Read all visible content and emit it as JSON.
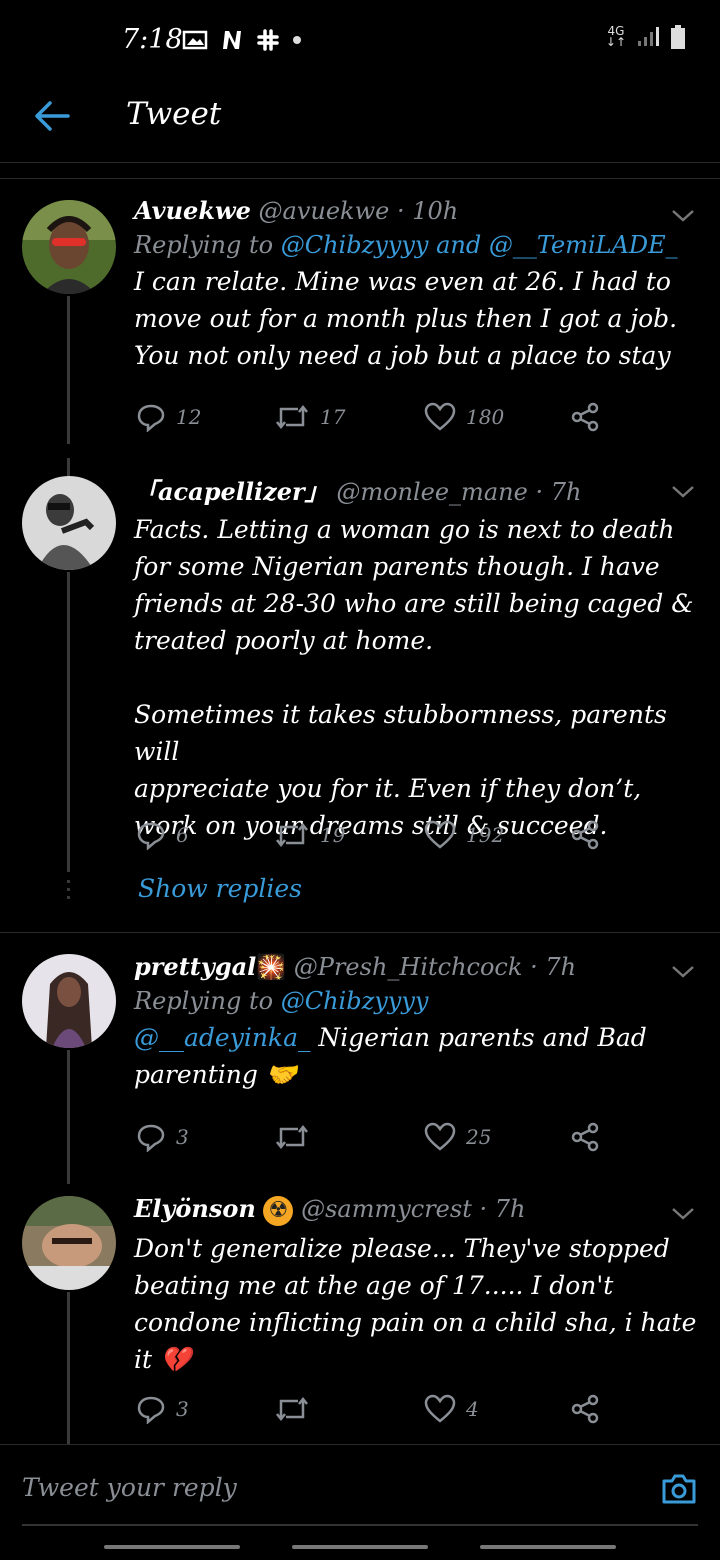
{
  "status_bar": {
    "time": "7:18",
    "network": "4G"
  },
  "header": {
    "title": "Tweet"
  },
  "tweets": [
    {
      "name": "Avuekwe",
      "handle": "@avuekwe",
      "time": "10h",
      "reply_prefix": "Replying to ",
      "reply_users": [
        "@Chibzyyyy",
        "@__TemiLADE_"
      ],
      "reply_joiner": " and ",
      "body": "I can relate. Mine was even at 26. I had to\nmove out for a month plus then I got a job.\nYou not only need a job but a place to stay",
      "replies": "12",
      "retweets": "17",
      "likes": "180"
    },
    {
      "name": "「acapellizer」",
      "handle": "@monlee_mane",
      "time": "7h",
      "body": "Facts. Letting a woman go is next to death\nfor some Nigerian parents though. I have\nfriends at 28-30 who are still being caged &\ntreated poorly at home.\n\nSometimes it takes stubbornness, parents will\nappreciate you for it. Even if they don’t,\nwork on your dreams still & succeed.",
      "replies": "6",
      "retweets": "19",
      "likes": "192",
      "show_replies": "Show replies"
    },
    {
      "name": "prettygal",
      "name_emoji": "🎇",
      "handle": "@Presh_Hitchcock",
      "time": "7h",
      "reply_prefix": "Replying to ",
      "reply_users": [
        "@Chibzyyyy"
      ],
      "mention": "@__adeyinka_",
      "body": " Nigerian parents and Bad\nparenting 🤝",
      "replies": "3",
      "retweets": "",
      "likes": "25"
    },
    {
      "name": "Elyönson",
      "name_emoji": "☢",
      "handle": "@sammycrest",
      "time": "7h",
      "body": "Don't generalize please... They've stopped\nbeating me at the age of 17..... I don't\ncondone inflicting pain on a child sha, i hate\nit 💔",
      "replies": "3",
      "retweets": "",
      "likes": "4"
    }
  ],
  "composer": {
    "placeholder": "Tweet your reply"
  },
  "colors": {
    "background": "#000000",
    "accent": "#3a9bd9",
    "muted": "#8a8f96"
  }
}
